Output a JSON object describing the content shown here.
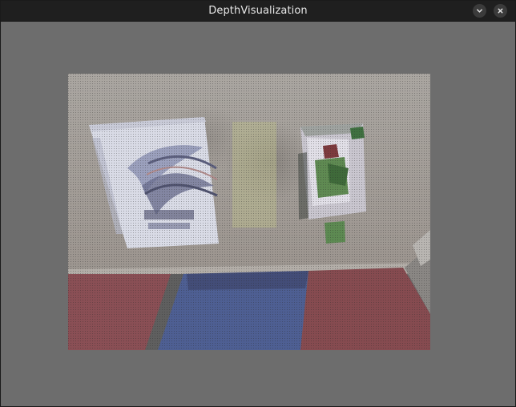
{
  "window": {
    "title": "DepthVisualization",
    "minimize_icon": "chevron-down-icon",
    "close_icon": "close-icon"
  },
  "colors": {
    "titlebar": "#1f1f1f",
    "background": "#6d6d6d",
    "table": "#a9a39c",
    "floor_red": "#8a4f55",
    "floor_blue": "#4e5f93"
  }
}
